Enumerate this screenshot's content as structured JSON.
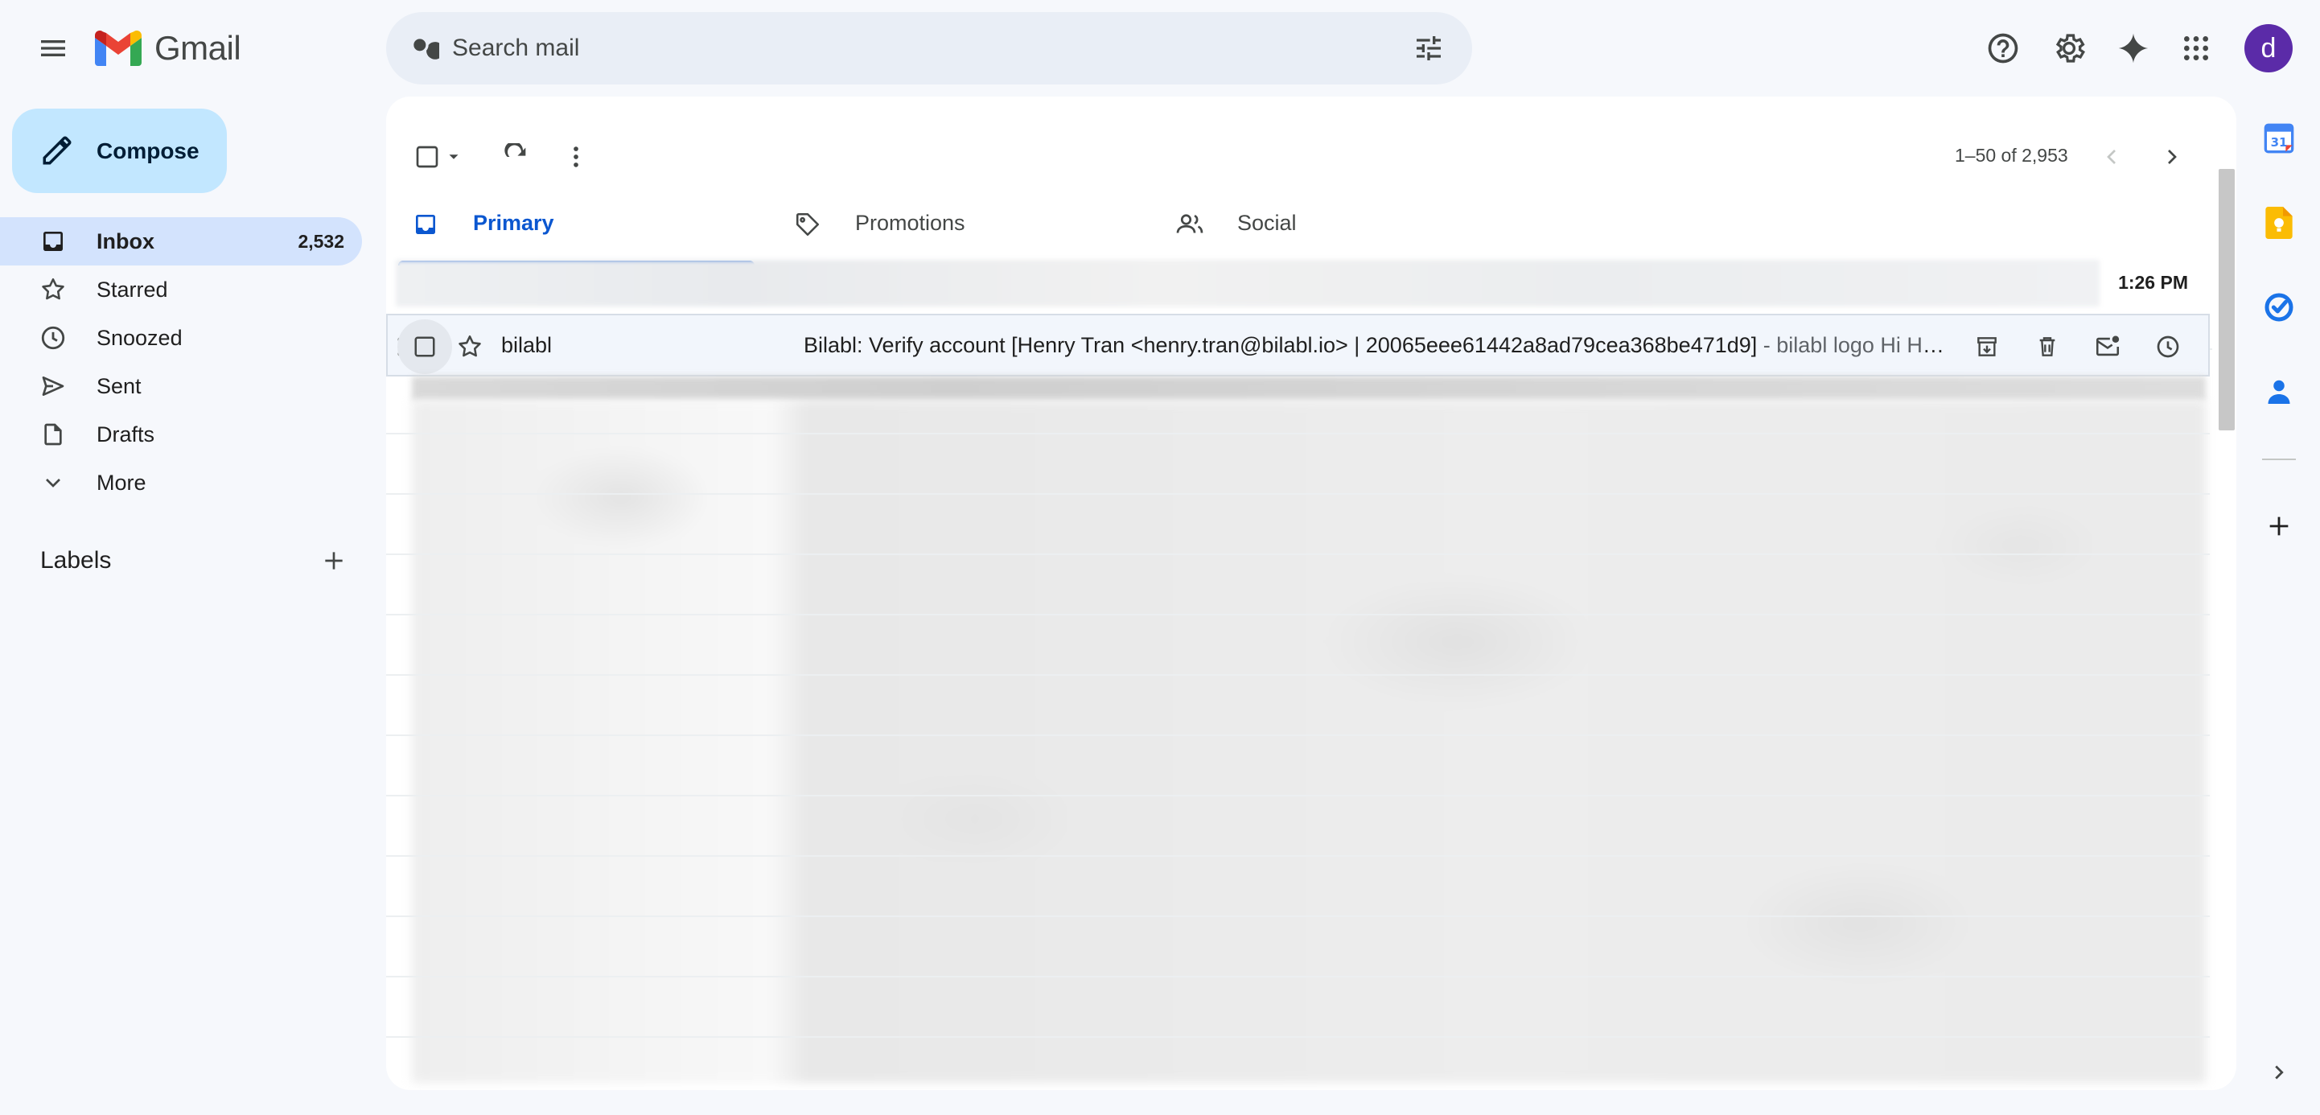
{
  "app": {
    "name": "Gmail",
    "avatar_initial": "d"
  },
  "search": {
    "placeholder": "Search mail"
  },
  "compose": {
    "label": "Compose"
  },
  "sidebar": {
    "items": [
      {
        "label": "Inbox",
        "count": "2,532",
        "icon": "inbox-icon",
        "active": true
      },
      {
        "label": "Starred",
        "count": "",
        "icon": "star-icon",
        "active": false
      },
      {
        "label": "Snoozed",
        "count": "",
        "icon": "clock-icon",
        "active": false
      },
      {
        "label": "Sent",
        "count": "",
        "icon": "send-icon",
        "active": false
      },
      {
        "label": "Drafts",
        "count": "",
        "icon": "draft-icon",
        "active": false
      },
      {
        "label": "More",
        "count": "",
        "icon": "chevron-down-icon",
        "active": false
      }
    ],
    "labels_title": "Labels"
  },
  "toolbar": {
    "pagination": "1–50 of 2,953"
  },
  "tabs": [
    {
      "label": "Primary",
      "icon": "inbox-icon",
      "active": true
    },
    {
      "label": "Promotions",
      "icon": "tag-icon",
      "active": false
    },
    {
      "label": "Social",
      "icon": "people-icon",
      "active": false
    }
  ],
  "emails": {
    "first_time": "1:26 PM",
    "hovered": {
      "sender": "bilabl",
      "subject": "Bilabl: Verify account [Henry Tran <henry.tran@bilabl.io> | 20065eee61442a8ad79cea368be471d9]",
      "snippet": " - bilabl logo Hi Henr..."
    }
  },
  "colors": {
    "accent": "#0b57d0",
    "compose_bg": "#c2e7ff",
    "active_nav_bg": "#d3e3fd",
    "avatar_bg": "#5b2ba8",
    "page_bg": "#f6f8fc"
  }
}
